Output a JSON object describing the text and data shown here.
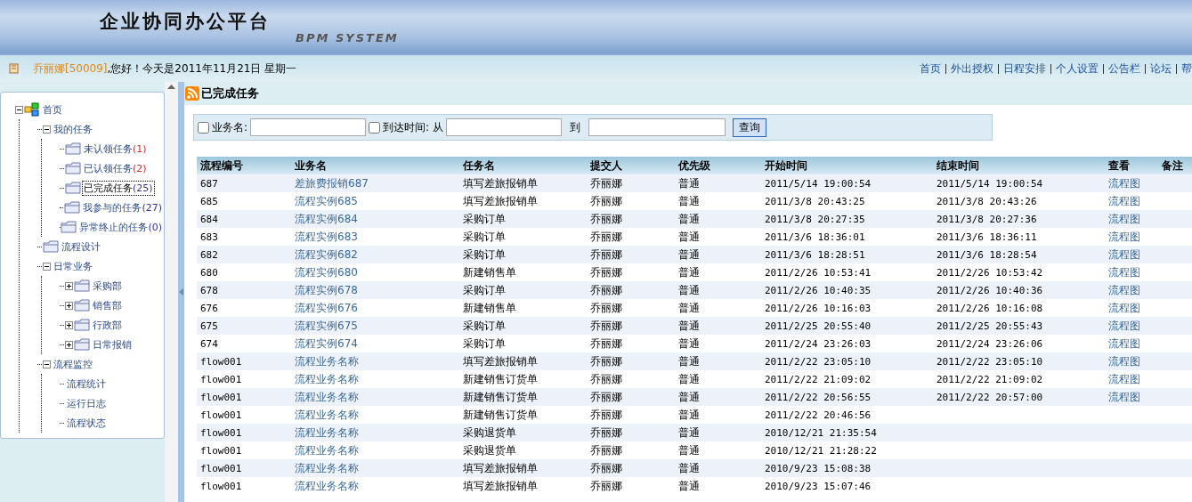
{
  "banner": {
    "title": "企业协同办公平台",
    "subtitle": "BPM SYSTEM"
  },
  "user_bar": {
    "user": "乔丽娜[50009]",
    "greeting": ",您好！今天是2011年11月21日  星期一"
  },
  "nav_links": [
    "首页",
    "外出授权",
    "日程安排",
    "个人设置",
    "公告栏",
    "论坛",
    "帮"
  ],
  "tree": [
    {
      "label": "首页",
      "kind": "root",
      "expanded": true,
      "selected": false,
      "children": [
        {
          "label": "我的任务",
          "kind": "plain",
          "expanded": true,
          "selected": false,
          "children": [
            {
              "label": "未认领任务",
              "count": "(1)",
              "color": "#cc3333",
              "kind": "folder",
              "selected": false
            },
            {
              "label": "已认领任务",
              "count": "(2)",
              "color": "#cc3333",
              "kind": "folder",
              "selected": false
            },
            {
              "label": "已完成任务",
              "count": "(25)",
              "color": "#333399",
              "kind": "folder",
              "selected": true
            },
            {
              "label": "我参与的任务",
              "count": "(27)",
              "color": "#333399",
              "kind": "folder",
              "selected": false
            },
            {
              "label": "异常终止的任务",
              "count": "(0)",
              "color": "#333399",
              "kind": "folder",
              "selected": false
            }
          ]
        },
        {
          "label": "流程设计",
          "kind": "folder",
          "selected": false
        },
        {
          "label": "日常业务",
          "kind": "plain",
          "expanded": true,
          "selected": false,
          "children": [
            {
              "label": "采购部",
              "kind": "folder",
              "expanded": false,
              "selected": false
            },
            {
              "label": "销售部",
              "kind": "folder",
              "expanded": false,
              "selected": false
            },
            {
              "label": "行政部",
              "kind": "folder",
              "expanded": false,
              "selected": false
            },
            {
              "label": "日常报销",
              "kind": "folder",
              "expanded": false,
              "selected": false
            }
          ]
        },
        {
          "label": "流程监控",
          "kind": "plain",
          "expanded": true,
          "selected": false,
          "children": [
            {
              "label": "流程统计",
              "kind": "plain",
              "selected": false
            },
            {
              "label": "运行日志",
              "kind": "plain",
              "selected": false
            },
            {
              "label": "流程状态",
              "kind": "plain",
              "selected": false
            }
          ]
        }
      ]
    }
  ],
  "panel_title": "已完成任务",
  "search": {
    "name_label": "业务名:",
    "name_checked": false,
    "time_label": "到达时间: 从",
    "time_checked": false,
    "to_label": "到",
    "button": "查询"
  },
  "table": {
    "columns": [
      "流程编号",
      "业务名",
      "任务名",
      "提交人",
      "优先级",
      "开始时间",
      "结束时间",
      "查看",
      "备注"
    ],
    "rows": [
      {
        "id": "687",
        "name": "差旅费报销687",
        "task": "填写差旅报销单",
        "submitter": "乔丽娜",
        "priority": "普通",
        "start": "2011/5/14 19:00:54",
        "end": "2011/5/14 19:00:54",
        "view": "流程图"
      },
      {
        "id": "685",
        "name": "流程实例685",
        "task": "填写差旅报销单",
        "submitter": "乔丽娜",
        "priority": "普通",
        "start": "2011/3/8 20:43:25",
        "end": "2011/3/8 20:43:26",
        "view": "流程图"
      },
      {
        "id": "684",
        "name": "流程实例684",
        "task": "采购订单",
        "submitter": "乔丽娜",
        "priority": "普通",
        "start": "2011/3/8 20:27:35",
        "end": "2011/3/8 20:27:36",
        "view": "流程图"
      },
      {
        "id": "683",
        "name": "流程实例683",
        "task": "采购订单",
        "submitter": "乔丽娜",
        "priority": "普通",
        "start": "2011/3/6 18:36:01",
        "end": "2011/3/6 18:36:11",
        "view": "流程图"
      },
      {
        "id": "682",
        "name": "流程实例682",
        "task": "采购订单",
        "submitter": "乔丽娜",
        "priority": "普通",
        "start": "2011/3/6 18:28:51",
        "end": "2011/3/6 18:28:54",
        "view": "流程图"
      },
      {
        "id": "680",
        "name": "流程实例680",
        "task": "新建销售单",
        "submitter": "乔丽娜",
        "priority": "普通",
        "start": "2011/2/26 10:53:41",
        "end": "2011/2/26 10:53:42",
        "view": "流程图"
      },
      {
        "id": "678",
        "name": "流程实例678",
        "task": "采购订单",
        "submitter": "乔丽娜",
        "priority": "普通",
        "start": "2011/2/26 10:40:35",
        "end": "2011/2/26 10:40:36",
        "view": "流程图"
      },
      {
        "id": "676",
        "name": "流程实例676",
        "task": "新建销售单",
        "submitter": "乔丽娜",
        "priority": "普通",
        "start": "2011/2/26 10:16:03",
        "end": "2011/2/26 10:16:08",
        "view": "流程图"
      },
      {
        "id": "675",
        "name": "流程实例675",
        "task": "采购订单",
        "submitter": "乔丽娜",
        "priority": "普通",
        "start": "2011/2/25 20:55:40",
        "end": "2011/2/25 20:55:43",
        "view": "流程图"
      },
      {
        "id": "674",
        "name": "流程实例674",
        "task": "采购订单",
        "submitter": "乔丽娜",
        "priority": "普通",
        "start": "2011/2/24 23:26:03",
        "end": "2011/2/24 23:26:06",
        "view": "流程图"
      },
      {
        "id": "flow001",
        "name": "流程业务名称",
        "task": "填写差旅报销单",
        "submitter": "乔丽娜",
        "priority": "普通",
        "start": "2011/2/22 23:05:10",
        "end": "2011/2/22 23:05:10",
        "view": "流程图"
      },
      {
        "id": "flow001",
        "name": "流程业务名称",
        "task": "新建销售订货单",
        "submitter": "乔丽娜",
        "priority": "普通",
        "start": "2011/2/22 21:09:02",
        "end": "2011/2/22 21:09:02",
        "view": "流程图"
      },
      {
        "id": "flow001",
        "name": "流程业务名称",
        "task": "新建销售订货单",
        "submitter": "乔丽娜",
        "priority": "普通",
        "start": "2011/2/22 20:56:55",
        "end": "2011/2/22 20:57:00",
        "view": "流程图"
      },
      {
        "id": "flow001",
        "name": "流程业务名称",
        "task": "新建销售订货单",
        "submitter": "乔丽娜",
        "priority": "普通",
        "start": "2011/2/22 20:46:56"
      },
      {
        "id": "flow001",
        "name": "流程业务名称",
        "task": "采购退货单",
        "submitter": "乔丽娜",
        "priority": "普通",
        "start": "2010/12/21 21:35:54"
      },
      {
        "id": "flow001",
        "name": "流程业务名称",
        "task": "采购退货单",
        "submitter": "乔丽娜",
        "priority": "普通",
        "start": "2010/12/21 21:28:22"
      },
      {
        "id": "flow001",
        "name": "流程业务名称",
        "task": "填写差旅报销单",
        "submitter": "乔丽娜",
        "priority": "普通",
        "start": "2010/9/23 15:08:38"
      },
      {
        "id": "flow001",
        "name": "流程业务名称",
        "task": "填写差旅报销单",
        "submitter": "乔丽娜",
        "priority": "普通",
        "start": "2010/9/23 15:07:46"
      }
    ]
  }
}
